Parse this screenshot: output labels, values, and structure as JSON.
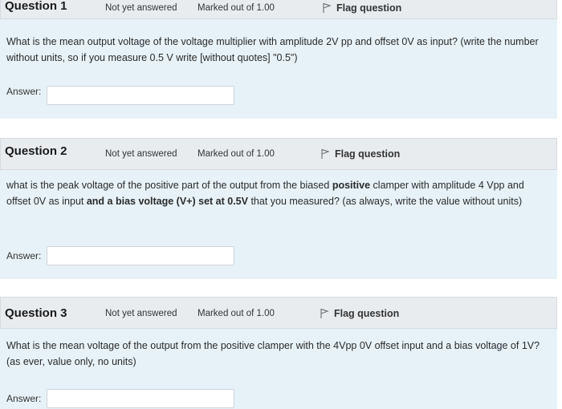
{
  "questions": [
    {
      "title": "Question 1",
      "status": "Not yet answered",
      "marks": "Marked out of 1.00",
      "flag_label": "Flag question",
      "text_parts": [
        {
          "text": "What is the mean output voltage of the voltage multiplier with amplitude 2V pp and offset 0V as input? (write the number without units, so if you measure 0.5 V write [without quotes] \"0.5\")",
          "bold": false
        }
      ],
      "answer_label": "Answer:",
      "answer_value": ""
    },
    {
      "title": "Question 2",
      "status": "Not yet answered",
      "marks": "Marked out of 1.00",
      "flag_label": "Flag question",
      "text_parts": [
        {
          "text": "what is the peak voltage of the positive part of the output from the biased ",
          "bold": false
        },
        {
          "text": "positive",
          "bold": true
        },
        {
          "text": " clamper with amplitude 4 Vpp and offset 0V as input ",
          "bold": false
        },
        {
          "text": "and a bias voltage (V+) set at 0.5V",
          "bold": true
        },
        {
          "text": " that you measured? (as always, write the value without units)",
          "bold": false
        }
      ],
      "answer_label": "Answer:",
      "answer_value": ""
    },
    {
      "title": "Question 3",
      "status": "Not yet answered",
      "marks": "Marked out of 1.00",
      "flag_label": "Flag question",
      "text_parts": [
        {
          "text": "What is the mean voltage of the output from the positive clamper with the 4Vpp 0V offset input and a bias voltage of 1V? (as ever, value only, no units)",
          "bold": false
        }
      ],
      "answer_label": "Answer:",
      "answer_value": ""
    }
  ],
  "icons": {
    "flag": "flag-icon"
  },
  "colors": {
    "header_bg": "#e9ecef",
    "body_bg": "#e6f2f8",
    "input_bg": "#ffffff"
  }
}
